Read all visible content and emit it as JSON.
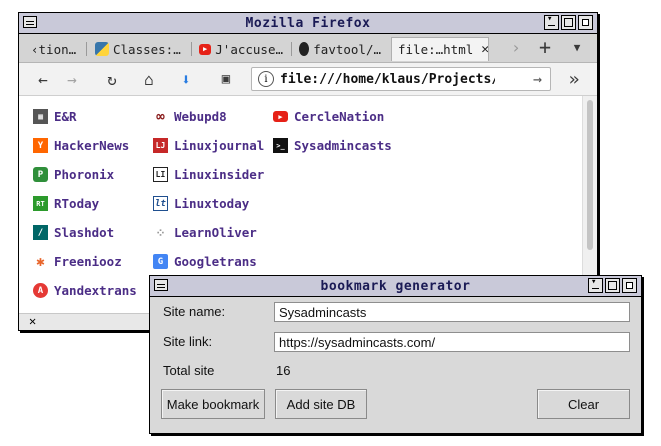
{
  "firefox": {
    "title": "Mozilla Firefox",
    "tabs": [
      {
        "label": "‹tion…"
      },
      {
        "label": "Classes:…"
      },
      {
        "label": "J'accuse…"
      },
      {
        "label": "favtool/…"
      },
      {
        "label": "file:…html"
      }
    ],
    "url": "file:///home/klaus/Projects/in",
    "bookmarks": [
      {
        "label": "E&R",
        "icon": "er-icon",
        "color": "#555555",
        "glyph": "▦"
      },
      {
        "label": "HackerNews",
        "icon": "hackernews-icon",
        "color": "#ff6600",
        "glyph": "Y"
      },
      {
        "label": "Phoronix",
        "icon": "phoronix-icon",
        "color": "#2f8f3a",
        "glyph": "P"
      },
      {
        "label": "RToday",
        "icon": "rt-icon",
        "color": "#2c9a2c",
        "glyph": "RT"
      },
      {
        "label": "Slashdot",
        "icon": "slashdot-icon",
        "color": "#006666",
        "glyph": "/"
      },
      {
        "label": "Freeniooz",
        "icon": "freeniooz-icon",
        "color": "#e8652b",
        "glyph": "✱"
      },
      {
        "label": "Yandextrans",
        "icon": "yandex-icon",
        "color": "#e53935",
        "glyph": "A"
      },
      {
        "label": "Webupd8",
        "icon": "webupd8-icon",
        "color": "#8a1c1c",
        "glyph": "∞"
      },
      {
        "label": "Linuxjournal",
        "icon": "linuxjournal-icon",
        "color": "#c62828",
        "glyph": "LJ"
      },
      {
        "label": "Linuxinsider",
        "icon": "linuxinsider-icon",
        "color": "#222222",
        "glyph": "LI"
      },
      {
        "label": "Linuxtoday",
        "icon": "linuxtoday-icon",
        "color": "#1f4f8f",
        "glyph": "lt"
      },
      {
        "label": "LearnOliver",
        "icon": "learnoliver-icon",
        "color": "#bbbbbb",
        "glyph": "·"
      },
      {
        "label": "Googletrans",
        "icon": "googletrans-icon",
        "color": "#4285f4",
        "glyph": "G"
      },
      {
        "label": "CercleNation",
        "icon": "youtube-icon",
        "color": "#e62117",
        "glyph": "▶"
      },
      {
        "label": "Sysadmincasts",
        "icon": "terminal-icon",
        "color": "#111111",
        "glyph": ">_"
      }
    ]
  },
  "dialog": {
    "title": "bookmark generator",
    "site_name_label": "Site name:",
    "site_name_value": "Sysadmincasts",
    "site_link_label": "Site link:",
    "site_link_value": "https://sysadmincasts.com/",
    "total_label": "Total site",
    "total_value": "16",
    "btn_make": "Make bookmark",
    "btn_add": "Add site DB",
    "btn_clear": "Clear"
  }
}
